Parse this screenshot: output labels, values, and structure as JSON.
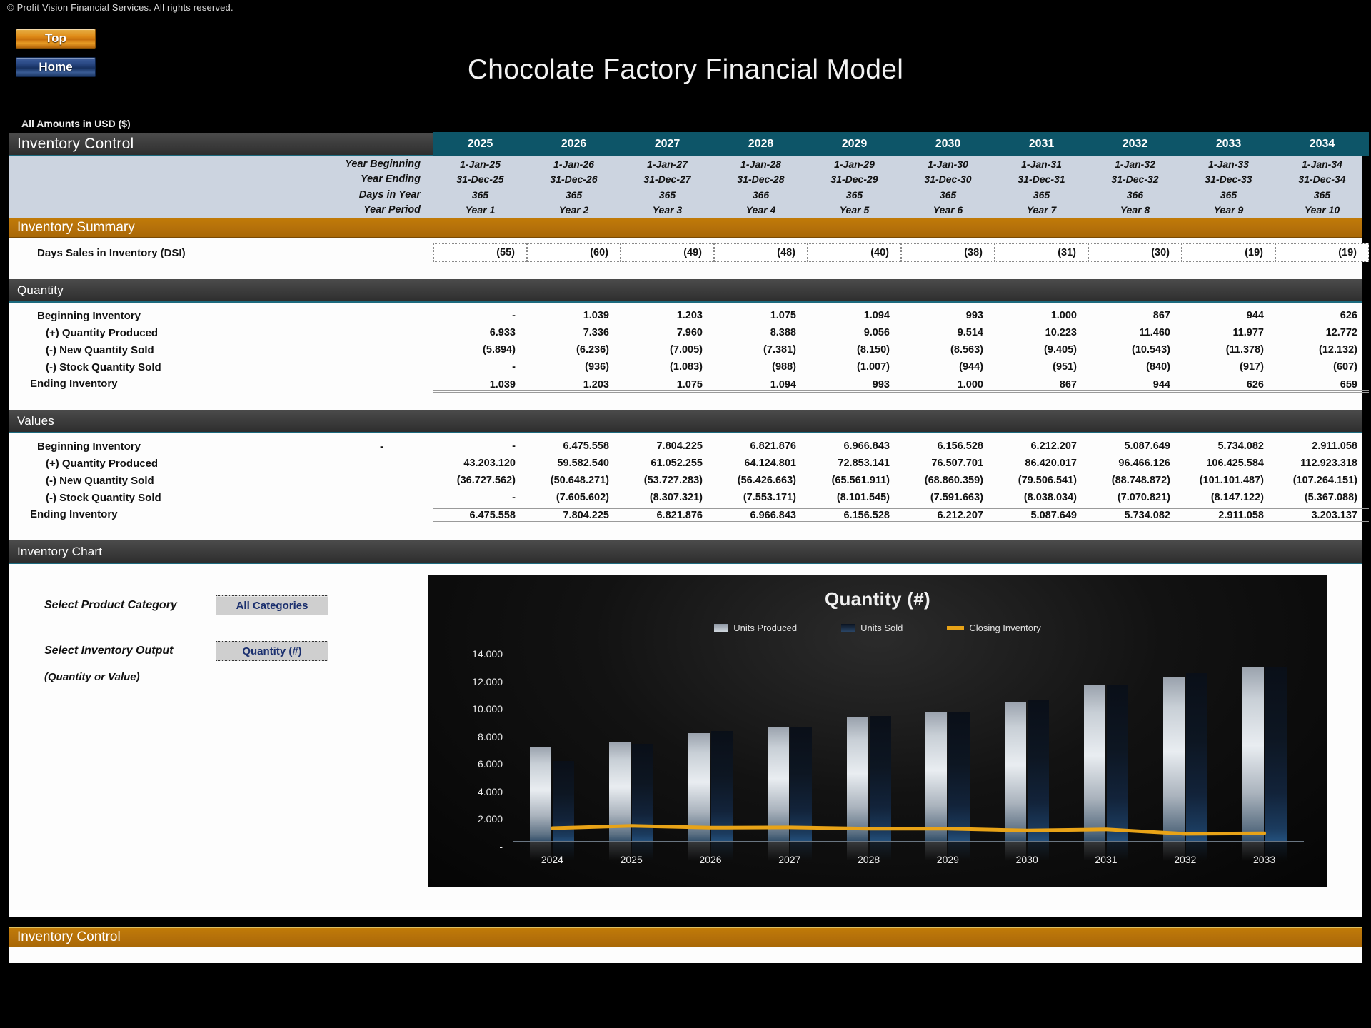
{
  "copyright": "© Profit Vision Financial Services. All rights reserved.",
  "nav": {
    "top_label": "Top",
    "home_label": "Home"
  },
  "header": {
    "title": "Chocolate Factory Financial Model",
    "amounts_note": "All Amounts in  USD ($)"
  },
  "table": {
    "section_title": "Inventory Control",
    "years": [
      "2025",
      "2026",
      "2027",
      "2028",
      "2029",
      "2030",
      "2031",
      "2032",
      "2033",
      "2034"
    ],
    "period_rows": [
      {
        "label": "Year Beginning",
        "values": [
          "1-Jan-25",
          "1-Jan-26",
          "1-Jan-27",
          "1-Jan-28",
          "1-Jan-29",
          "1-Jan-30",
          "1-Jan-31",
          "1-Jan-32",
          "1-Jan-33",
          "1-Jan-34"
        ]
      },
      {
        "label": "Year Ending",
        "values": [
          "31-Dec-25",
          "31-Dec-26",
          "31-Dec-27",
          "31-Dec-28",
          "31-Dec-29",
          "31-Dec-30",
          "31-Dec-31",
          "31-Dec-32",
          "31-Dec-33",
          "31-Dec-34"
        ]
      },
      {
        "label": "Days in Year",
        "values": [
          "365",
          "365",
          "365",
          "366",
          "365",
          "365",
          "365",
          "366",
          "365",
          "365"
        ]
      },
      {
        "label": "Year Period",
        "values": [
          "Year 1",
          "Year 2",
          "Year 3",
          "Year 4",
          "Year 5",
          "Year 6",
          "Year 7",
          "Year 8",
          "Year 9",
          "Year 10"
        ]
      }
    ],
    "summary_title": "Inventory Summary",
    "dsi": {
      "label": "Days Sales in Inventory (DSI)",
      "values": [
        "(55)",
        "(60)",
        "(49)",
        "(48)",
        "(40)",
        "(38)",
        "(31)",
        "(30)",
        "(19)",
        "(19)"
      ]
    },
    "quantity_title": "Quantity",
    "quantity_rows": [
      {
        "label": "Beginning Inventory",
        "values": [
          "-",
          "1.039",
          "1.203",
          "1.075",
          "1.094",
          "993",
          "1.000",
          "867",
          "944",
          "626"
        ]
      },
      {
        "label": "(+) Quantity Produced",
        "values": [
          "6.933",
          "7.336",
          "7.960",
          "8.388",
          "9.056",
          "9.514",
          "10.223",
          "11.460",
          "11.977",
          "12.772"
        ]
      },
      {
        "label": "(-) New Quantity Sold",
        "values": [
          "(5.894)",
          "(6.236)",
          "(7.005)",
          "(7.381)",
          "(8.150)",
          "(8.563)",
          "(9.405)",
          "(10.543)",
          "(11.378)",
          "(12.132)"
        ]
      },
      {
        "label": "(-) Stock Quantity Sold",
        "values": [
          "-",
          "(936)",
          "(1.083)",
          "(988)",
          "(1.007)",
          "(944)",
          "(951)",
          "(840)",
          "(917)",
          "(607)"
        ]
      }
    ],
    "quantity_total": {
      "label": "Ending Inventory",
      "values": [
        "1.039",
        "1.203",
        "1.075",
        "1.094",
        "993",
        "1.000",
        "867",
        "944",
        "626",
        "659"
      ]
    },
    "values_title": "Values",
    "values_rows": [
      {
        "label": "Beginning Inventory",
        "values": [
          "-",
          "-",
          "6.475.558",
          "7.804.225",
          "6.821.876",
          "6.966.843",
          "6.156.528",
          "6.212.207",
          "5.087.649",
          "5.734.082",
          "2.911.058"
        ]
      },
      {
        "label": "(+) Quantity Produced",
        "values": [
          "43.203.120",
          "59.582.540",
          "61.052.255",
          "64.124.801",
          "72.853.141",
          "76.507.701",
          "86.420.017",
          "96.466.126",
          "106.425.584",
          "112.923.318"
        ]
      },
      {
        "label": "(-) New Quantity Sold",
        "values": [
          "(36.727.562)",
          "(50.648.271)",
          "(53.727.283)",
          "(56.426.663)",
          "(65.561.911)",
          "(68.860.359)",
          "(79.506.541)",
          "(88.748.872)",
          "(101.101.487)",
          "(107.264.151)"
        ]
      },
      {
        "label": "(-) Stock Quantity Sold",
        "values": [
          "-",
          "(7.605.602)",
          "(8.307.321)",
          "(7.553.171)",
          "(8.101.545)",
          "(7.591.663)",
          "(8.038.034)",
          "(7.070.821)",
          "(8.147.122)",
          "(5.367.088)"
        ]
      }
    ],
    "values_begin_dash": "-",
    "values_total": {
      "label": "Ending Inventory",
      "values": [
        "6.475.558",
        "7.804.225",
        "6.821.876",
        "6.966.843",
        "6.156.528",
        "6.212.207",
        "5.087.649",
        "5.734.082",
        "2.911.058",
        "3.203.137"
      ]
    }
  },
  "chart_panel": {
    "section_title": "Inventory Chart",
    "category_label": "Select Product Category",
    "category_value": "All Categories",
    "output_label": "Select Inventory Output",
    "output_value": "Quantity (#)",
    "output_hint": "(Quantity or Value)"
  },
  "footer": {
    "section_title": "Inventory Control"
  },
  "chart_data": {
    "type": "bar",
    "title": "Quantity (#)",
    "xlabel": "",
    "ylabel": "",
    "ylim": [
      0,
      14000
    ],
    "yticks": [
      "14.000",
      "12.000",
      "10.000",
      "8.000",
      "6.000",
      "4.000",
      "2.000",
      "-"
    ],
    "ytick_values": [
      14000,
      12000,
      10000,
      8000,
      6000,
      4000,
      2000,
      0
    ],
    "grid": false,
    "legend_position": "top",
    "categories": [
      "2024",
      "2025",
      "2026",
      "2027",
      "2028",
      "2029",
      "2030",
      "2031",
      "2032",
      "2033"
    ],
    "series": [
      {
        "name": "Units Produced",
        "type": "bar",
        "color": "#c8cfd6",
        "values": [
          6933,
          7336,
          7960,
          8388,
          9056,
          9514,
          10223,
          11460,
          11977,
          12772
        ]
      },
      {
        "name": "Units Sold",
        "type": "bar",
        "color": "#12233a",
        "values": [
          5894,
          7172,
          8088,
          8369,
          9157,
          9507,
          10356,
          11383,
          12295,
          12739
        ]
      },
      {
        "name": "Closing Inventory",
        "type": "line",
        "color": "#e8a317",
        "values": [
          1039,
          1203,
          1075,
          1094,
          993,
          1000,
          867,
          944,
          626,
          659
        ]
      }
    ]
  },
  "colors": {
    "accent_orange": "#b5710a",
    "header_teal": "#0d5568",
    "section_gray": "#3b3b3b",
    "period_blue": "#ccd4e0",
    "line_orange": "#e8a317"
  }
}
